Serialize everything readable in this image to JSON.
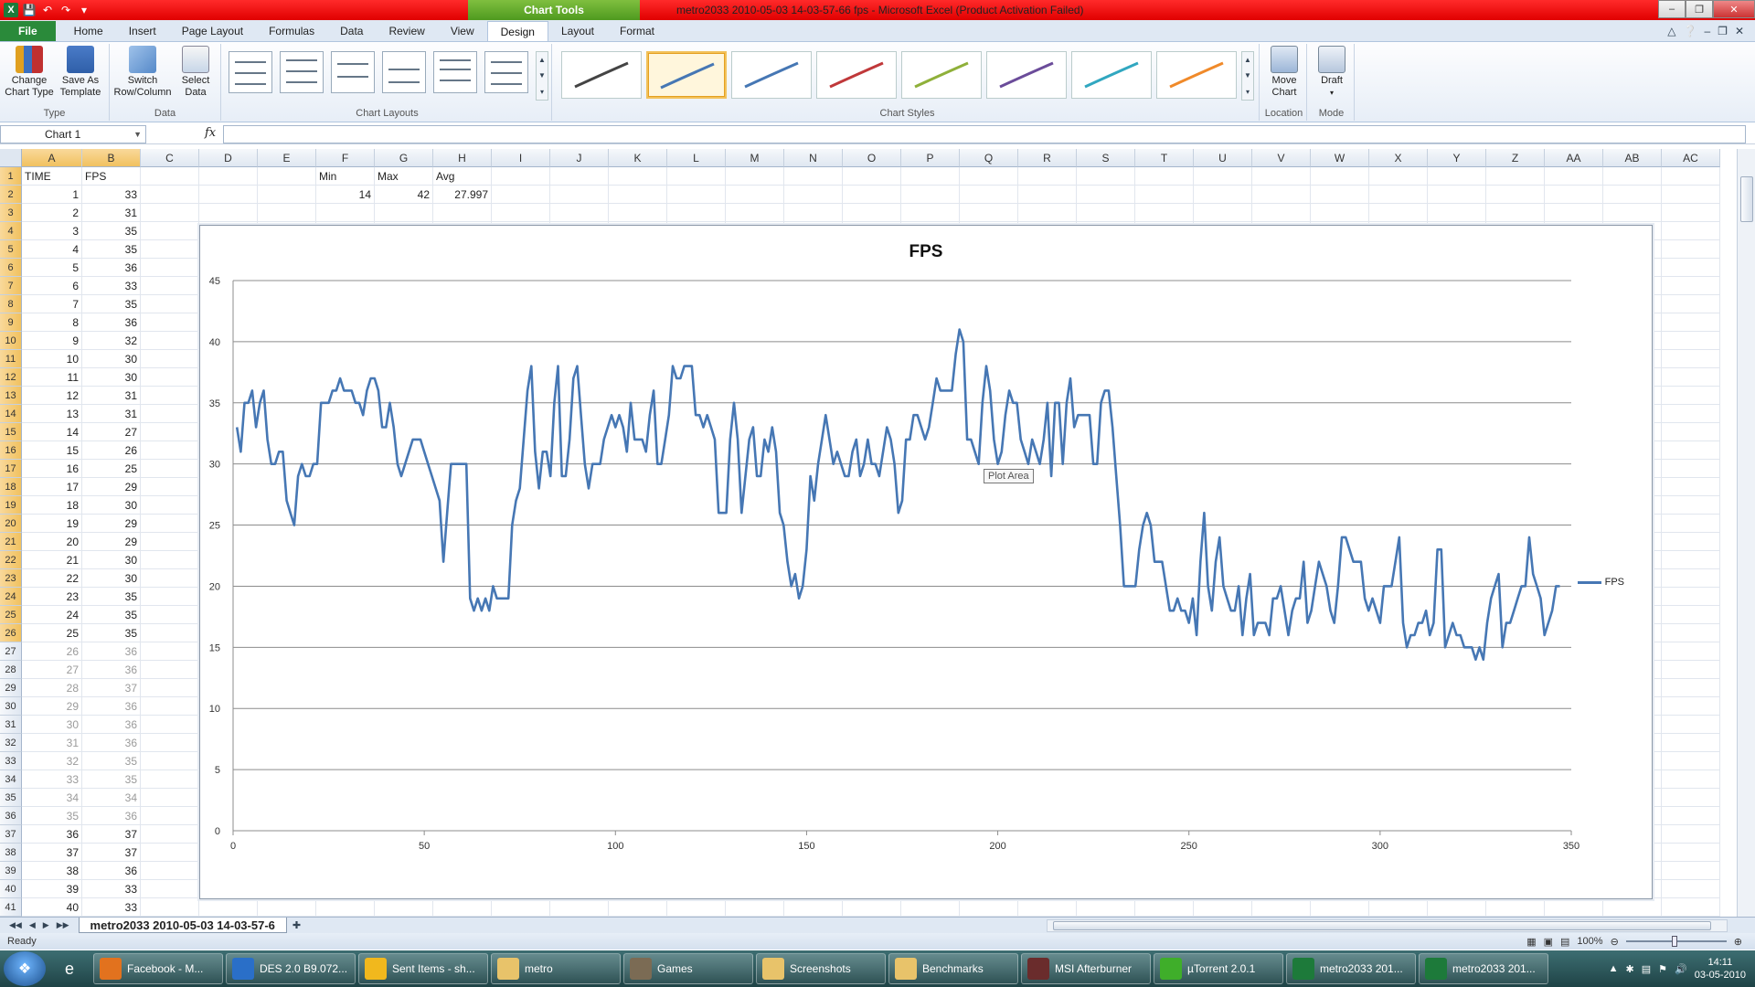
{
  "window": {
    "title": "metro2033 2010-05-03 14-03-57-66 fps  -  Microsoft Excel (Product Activation Failed)",
    "context_tab": "Chart Tools"
  },
  "ribbon": {
    "tabs": [
      "File",
      "Home",
      "Insert",
      "Page Layout",
      "Formulas",
      "Data",
      "Review",
      "View",
      "Design",
      "Layout",
      "Format"
    ],
    "active_tab": "Design",
    "groups": {
      "type": {
        "label": "Type",
        "change_chart_type": "Change Chart Type",
        "save_as_template": "Save As Template"
      },
      "data": {
        "label": "Data",
        "switch_row_column": "Switch Row/Column",
        "select_data": "Select Data"
      },
      "chart_layouts": {
        "label": "Chart Layouts"
      },
      "chart_styles": {
        "label": "Chart Styles",
        "style_colors": [
          "#444444",
          "#4677b4",
          "#4677b4",
          "#c0383a",
          "#8fb03a",
          "#6b4c9a",
          "#31a7c0",
          "#f08a2a"
        ]
      },
      "location": {
        "label": "Location",
        "move_chart": "Move Chart"
      },
      "mode": {
        "label": "Mode",
        "draft": "Draft"
      }
    }
  },
  "formula_bar": {
    "name_box": "Chart 1",
    "fx": "fx",
    "formula": ""
  },
  "columns": [
    "A",
    "B",
    "C",
    "D",
    "E",
    "F",
    "G",
    "H",
    "I",
    "J",
    "K",
    "L",
    "M",
    "N",
    "O",
    "P",
    "Q",
    "R",
    "S",
    "T",
    "U",
    "V",
    "W",
    "X",
    "Y",
    "Z",
    "AA",
    "AB",
    "AC"
  ],
  "sheet": {
    "headers": {
      "A1": "TIME",
      "B1": "FPS",
      "F1": "Min",
      "G1": "Max",
      "H1": "Avg"
    },
    "stats": {
      "F2": "14",
      "G2": "42",
      "H2": "27.997"
    },
    "rows": [
      [
        1,
        33
      ],
      [
        2,
        31
      ],
      [
        3,
        35
      ],
      [
        4,
        35
      ],
      [
        5,
        36
      ],
      [
        6,
        33
      ],
      [
        7,
        35
      ],
      [
        8,
        36
      ],
      [
        9,
        32
      ],
      [
        10,
        30
      ],
      [
        11,
        30
      ],
      [
        12,
        31
      ],
      [
        13,
        31
      ],
      [
        14,
        27
      ],
      [
        15,
        26
      ],
      [
        16,
        25
      ],
      [
        17,
        29
      ],
      [
        18,
        30
      ],
      [
        19,
        29
      ],
      [
        20,
        29
      ],
      [
        21,
        30
      ],
      [
        22,
        30
      ],
      [
        23,
        35
      ],
      [
        24,
        35
      ],
      [
        25,
        35
      ],
      [
        26,
        36
      ],
      [
        27,
        36
      ],
      [
        28,
        37
      ],
      [
        29,
        36
      ],
      [
        30,
        36
      ],
      [
        31,
        36
      ],
      [
        32,
        35
      ],
      [
        33,
        35
      ],
      [
        34,
        34
      ],
      [
        35,
        36
      ],
      [
        36,
        37
      ],
      [
        37,
        37
      ],
      [
        38,
        36
      ],
      [
        39,
        33
      ],
      [
        40,
        33
      ]
    ]
  },
  "chart_data": {
    "type": "line",
    "title": "FPS",
    "xlim": [
      0,
      350
    ],
    "ylim": [
      0,
      45
    ],
    "x_ticks": [
      0,
      50,
      100,
      150,
      200,
      250,
      300,
      350
    ],
    "y_ticks": [
      0,
      5,
      10,
      15,
      20,
      25,
      30,
      35,
      40,
      45
    ],
    "grid": true,
    "legend_position": "right",
    "series": [
      {
        "name": "FPS",
        "color": "#4677b4",
        "values": [
          33,
          31,
          35,
          35,
          36,
          33,
          35,
          36,
          32,
          30,
          30,
          31,
          31,
          27,
          26,
          25,
          29,
          30,
          29,
          29,
          30,
          30,
          35,
          35,
          35,
          36,
          36,
          37,
          36,
          36,
          36,
          35,
          35,
          34,
          36,
          37,
          37,
          36,
          33,
          33,
          35,
          33,
          30,
          29,
          30,
          31,
          32,
          32,
          32,
          31,
          30,
          29,
          28,
          27,
          22,
          26,
          30,
          30,
          30,
          30,
          30,
          19,
          18,
          19,
          18,
          19,
          18,
          20,
          19,
          19,
          19,
          19,
          25,
          27,
          28,
          32,
          36,
          38,
          31,
          28,
          31,
          31,
          29,
          35,
          38,
          29,
          29,
          32,
          37,
          38,
          34,
          30,
          28,
          30,
          30,
          30,
          32,
          33,
          34,
          33,
          34,
          33,
          31,
          35,
          32,
          32,
          32,
          31,
          34,
          36,
          30,
          30,
          32,
          34,
          38,
          37,
          37,
          38,
          38,
          38,
          34,
          34,
          33,
          34,
          33,
          32,
          26,
          26,
          26,
          32,
          35,
          32,
          26,
          29,
          32,
          33,
          29,
          29,
          32,
          31,
          33,
          31,
          26,
          25,
          22,
          20,
          21,
          19,
          20,
          23,
          29,
          27,
          30,
          32,
          34,
          32,
          30,
          31,
          30,
          29,
          29,
          31,
          32,
          29,
          30,
          32,
          30,
          30,
          29,
          31,
          33,
          32,
          30,
          26,
          27,
          32,
          32,
          34,
          34,
          33,
          32,
          33,
          35,
          37,
          36,
          36,
          36,
          36,
          39,
          41,
          40,
          32,
          32,
          31,
          30,
          35,
          38,
          36,
          32,
          30,
          31,
          34,
          36,
          35,
          35,
          32,
          31,
          30,
          32,
          31,
          30,
          32,
          35,
          29,
          35,
          35,
          30,
          35,
          37,
          33,
          34,
          34,
          34,
          34,
          30,
          30,
          35,
          36,
          36,
          33,
          29,
          25,
          20,
          20,
          20,
          20,
          23,
          25,
          26,
          25,
          22,
          22,
          22,
          20,
          18,
          18,
          19,
          18,
          18,
          17,
          19,
          16,
          22,
          26,
          20,
          18,
          22,
          24,
          20,
          19,
          18,
          18,
          20,
          16,
          19,
          21,
          16,
          17,
          17,
          17,
          16,
          19,
          19,
          20,
          18,
          16,
          18,
          19,
          19,
          22,
          17,
          18,
          20,
          22,
          21,
          20,
          18,
          17,
          20,
          24,
          24,
          23,
          22,
          22,
          22,
          19,
          18,
          19,
          18,
          17,
          20,
          20,
          20,
          22,
          24,
          17,
          15,
          16,
          16,
          17,
          17,
          18,
          16,
          17,
          23,
          23,
          15,
          16,
          17,
          16,
          16,
          15,
          15,
          15,
          14,
          15,
          14,
          17,
          19,
          20,
          21,
          15,
          17,
          17,
          18,
          19,
          20,
          20,
          24,
          21,
          20,
          19,
          16,
          17,
          18,
          20,
          20
        ]
      }
    ]
  },
  "chart_tooltip": "Plot Area",
  "sheet_tab": "metro2033 2010-05-03 14-03-57-6",
  "status": {
    "ready": "Ready",
    "zoom": "100%"
  },
  "taskbar": {
    "buttons": [
      {
        "label": "Facebook - M...",
        "color": "#e2721e"
      },
      {
        "label": "DES 2.0 B9.072...",
        "color": "#2a6fc8"
      },
      {
        "label": "Sent Items - sh...",
        "color": "#f1b81d"
      },
      {
        "label": "metro",
        "color": "#e8c36a"
      },
      {
        "label": "Games",
        "color": "#7b6b54"
      },
      {
        "label": "Screenshots",
        "color": "#e8c36a"
      },
      {
        "label": "Benchmarks",
        "color": "#e8c36a"
      },
      {
        "label": "MSI Afterburner",
        "color": "#6a2c2c"
      },
      {
        "label": "µTorrent 2.0.1",
        "color": "#3fae2a"
      },
      {
        "label": "metro2033 201...",
        "color": "#1d7a3a"
      },
      {
        "label": "metro2033 201...",
        "color": "#1d7a3a"
      }
    ],
    "time": "14:11",
    "date": "03-05-2010"
  }
}
